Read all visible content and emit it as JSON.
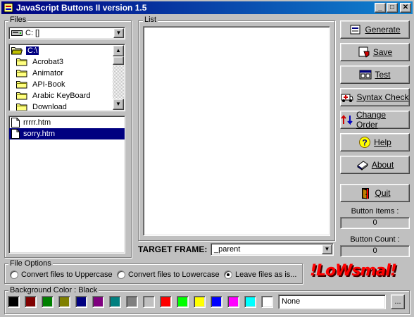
{
  "window": {
    "title": "JavaScript Buttons II  version 1.5"
  },
  "files": {
    "group_label": "Files",
    "drive_value": "C: []",
    "folders": [
      {
        "name": "C:\\",
        "selected": true
      },
      {
        "name": "Acrobat3"
      },
      {
        "name": "Animator"
      },
      {
        "name": "API-Book"
      },
      {
        "name": "Arabic KeyBoard"
      },
      {
        "name": "Download"
      }
    ],
    "file_items": [
      {
        "name": "rrrrr.htm",
        "selected": false
      },
      {
        "name": "sorry.htm",
        "selected": true
      }
    ]
  },
  "list": {
    "group_label": "List"
  },
  "target_frame": {
    "label": "TARGET FRAME:",
    "value": "_parent"
  },
  "buttons": {
    "generate": "Generate",
    "save": "Save",
    "test": "Test",
    "syntax_check": "Syntax Check",
    "change_order": "Change Order",
    "help": "Help",
    "about": "About",
    "quit": "Quit"
  },
  "counters": {
    "items_label": "Button Items :",
    "items_value": "0",
    "count_label": "Button Count :",
    "count_value": "0"
  },
  "file_options": {
    "group_label": "File Options",
    "options": [
      {
        "label": "Convert files to Uppercase",
        "checked": false
      },
      {
        "label": "Convert files to Lowercase",
        "checked": false
      },
      {
        "label": "Leave files as is...",
        "checked": true
      }
    ]
  },
  "logo_text": "!LoWsmal!",
  "background": {
    "group_label": "Background Color : Black",
    "colors": [
      "#000000",
      "#800000",
      "#008000",
      "#808000",
      "#000080",
      "#800080",
      "#008080",
      "#808080",
      "#c0c0c0",
      "#ff0000",
      "#00ff00",
      "#ffff00",
      "#0000ff",
      "#ff00ff",
      "#00ffff",
      "#ffffff"
    ],
    "image_value": "None",
    "browse_label": "..."
  }
}
